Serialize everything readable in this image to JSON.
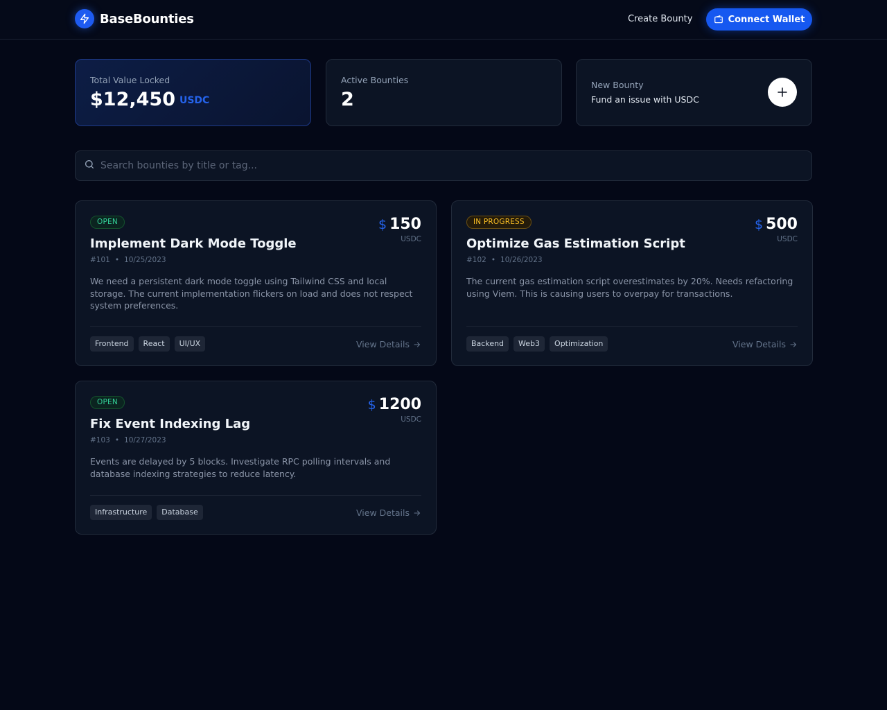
{
  "brand": {
    "name": "BaseBounties",
    "icon": "lightning-icon"
  },
  "nav": {
    "create_bounty": "Create Bounty",
    "connect_wallet": "Connect Wallet",
    "wallet_icon": "wallet-icon"
  },
  "stats": {
    "tvl": {
      "label": "Total Value Locked",
      "value": "$12,450",
      "unit": "USDC"
    },
    "active": {
      "label": "Active Bounties",
      "value": "2"
    },
    "new_bounty": {
      "title": "New Bounty",
      "subtitle": "Fund an issue with USDC",
      "icon": "plus-icon"
    }
  },
  "search": {
    "placeholder": "Search bounties by title or tag...",
    "value": ""
  },
  "bounties": [
    {
      "status": "OPEN",
      "title": "Implement Dark Mode Toggle",
      "id": "#101",
      "date": "10/25/2023",
      "amount_symbol": "$",
      "amount": "150",
      "unit": "USDC",
      "description": "We need a persistent dark mode toggle using Tailwind CSS and local storage. The current implementation flickers on load and does not respect system preferences.",
      "tags": [
        "Frontend",
        "React",
        "UI/UX"
      ],
      "action": "View Details"
    },
    {
      "status": "IN PROGRESS",
      "title": "Optimize Gas Estimation Script",
      "id": "#102",
      "date": "10/26/2023",
      "amount_symbol": "$",
      "amount": "500",
      "unit": "USDC",
      "description": "The current gas estimation script overestimates by 20%. Needs refactoring using Viem. This is causing users to overpay for transactions.",
      "tags": [
        "Backend",
        "Web3",
        "Optimization"
      ],
      "action": "View Details"
    },
    {
      "status": "OPEN",
      "title": "Fix Event Indexing Lag",
      "id": "#103",
      "date": "10/27/2023",
      "amount_symbol": "$",
      "amount": "1200",
      "unit": "USDC",
      "description": "Events are delayed by 5 blocks. Investigate RPC polling intervals and database indexing strategies to reduce latency.",
      "tags": [
        "Infrastructure",
        "Database"
      ],
      "action": "View Details"
    }
  ],
  "colors": {
    "accent": "#1658f0",
    "open": "#34d399",
    "in_progress": "#fbbf24",
    "background": "#040817"
  }
}
